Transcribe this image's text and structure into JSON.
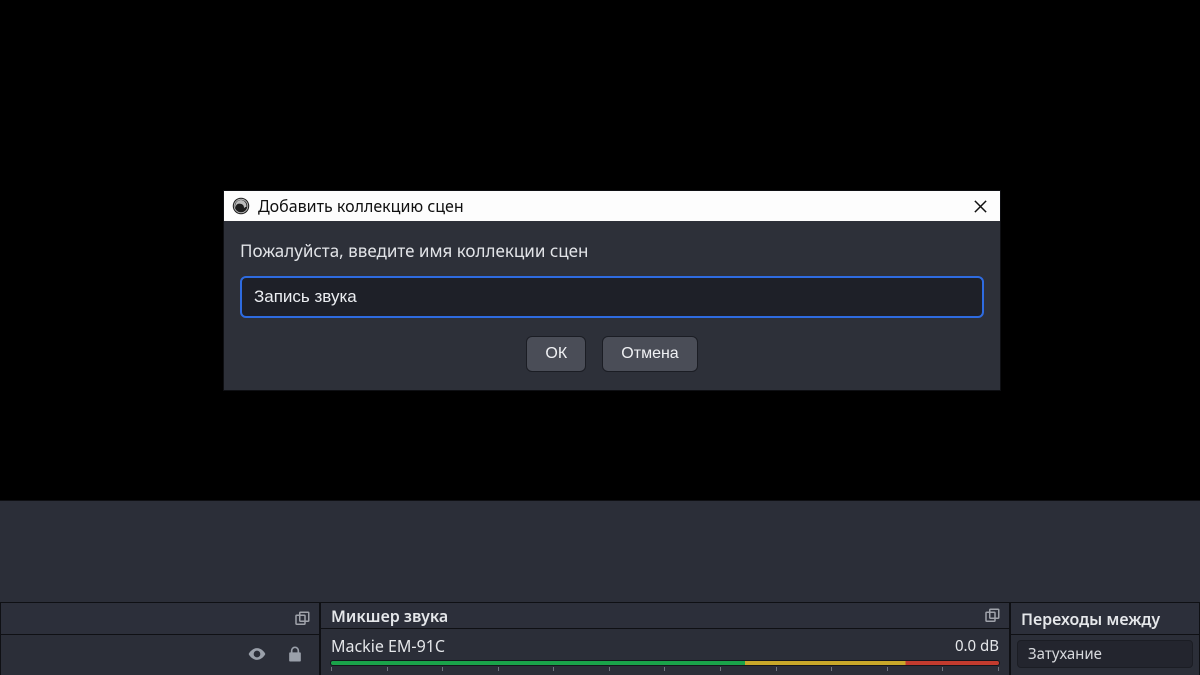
{
  "dialog": {
    "title": "Добавить коллекцию сцен",
    "prompt": "Пожалуйста, введите имя коллекции сцен",
    "input_value": "Запись звука",
    "ok_label": "ОК",
    "cancel_label": "Отмена"
  },
  "docks": {
    "sources": {
      "title": ""
    },
    "mixer": {
      "title": "Микшер звука",
      "channels": [
        {
          "name": "Mackie EM-91C",
          "db": "0.0 dB"
        }
      ]
    },
    "transitions": {
      "title": "Переходы между",
      "selected": "Затухание"
    }
  }
}
